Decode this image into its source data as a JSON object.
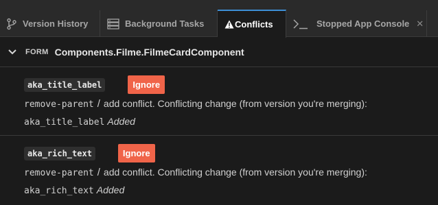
{
  "tabs": [
    {
      "label": "Version History",
      "icon": "branch-icon"
    },
    {
      "label": "Background Tasks",
      "icon": "tasks-icon"
    },
    {
      "label": "Conflicts",
      "icon": "warning-icon",
      "active": true
    },
    {
      "label": "Stopped App Console",
      "icon": "terminal-icon",
      "close": "✕"
    }
  ],
  "form": {
    "kind": "FORM",
    "title": "Components.Filme.FilmeCardComponent"
  },
  "conflicts": [
    {
      "property": "aka_title_label",
      "ignore_label": "Ignore",
      "op_a": "remove-parent",
      "slash": "/",
      "op_b": "add",
      "message": "conflict. Conflicting change  (from version you're merging):",
      "target": "aka_title_label",
      "status": "Added"
    },
    {
      "property": "aka_rich_text",
      "ignore_label": "Ignore",
      "op_a": "remove-parent",
      "slash": "/",
      "op_b": "add",
      "message": "conflict. Conflicting change  (from version you're merging):",
      "target": "aka_rich_text",
      "status": "Added"
    }
  ],
  "colors": {
    "accent": "#3d8fd6",
    "ignore": "#f06449",
    "background": "#1b1b1b",
    "tabbar": "#2a2a2a"
  }
}
